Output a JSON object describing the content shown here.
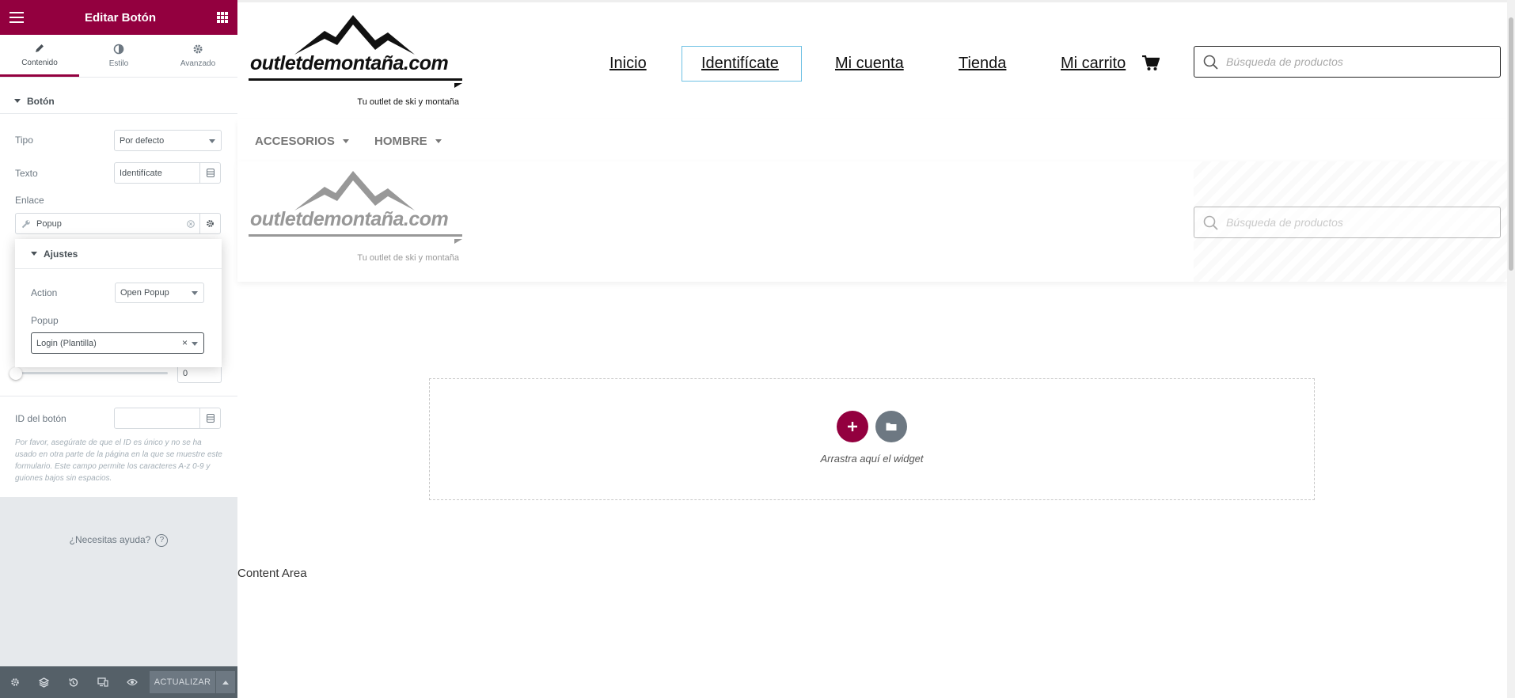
{
  "panel": {
    "title": "Editar Botón",
    "tabs": [
      {
        "label": "Contenido",
        "icon": "pencil-icon"
      },
      {
        "label": "Estilo",
        "icon": "contrast-icon"
      },
      {
        "label": "Avanzado",
        "icon": "gear-icon"
      }
    ],
    "section_title": "Botón",
    "tipo": {
      "label": "Tipo",
      "value": "Por defecto"
    },
    "texto": {
      "label": "Texto",
      "value": "Identifícate"
    },
    "enlace": {
      "label": "Enlace",
      "value": "Popup"
    },
    "ajustes": {
      "title": "Ajustes",
      "action_label": "Action",
      "action_value": "Open Popup",
      "popup_label": "Popup",
      "popup_value": "Login (Plantilla)",
      "clear_symbol": "×"
    },
    "slider_value": "0",
    "id_boton": {
      "label": "ID del botón",
      "value": ""
    },
    "help_text": "Por favor, asegúrate de que el ID es único y no se ha usado en otra parte de la página en la que se muestre este formulario. Este campo permite los caracteres A-z 0-9 y guiones bajos sin espacios.",
    "need_help": "¿Necesitas ayuda?",
    "help_icon": "?",
    "update_label": "ACTUALIZAR",
    "accent": "#93003f"
  },
  "site": {
    "logo_text": "outletdemontaña.com",
    "tagline": "Tu outlet de ski y montaña",
    "nav": [
      "Inicio",
      "Identifícate",
      "Mi cuenta",
      "Tienda",
      "Mi carrito"
    ],
    "search_placeholder": "Búsqueda de productos",
    "menu": [
      "ACCESORIOS",
      "HOMBRE"
    ],
    "dropzone_text": "Arrastra aquí el widget",
    "content_area": "Content Area"
  }
}
